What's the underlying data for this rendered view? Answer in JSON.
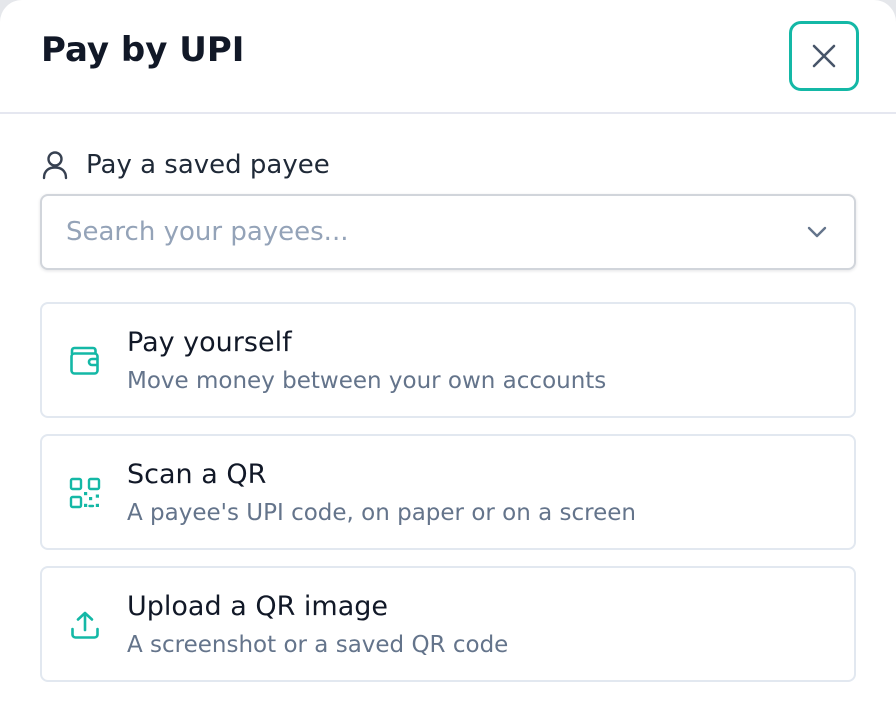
{
  "header": {
    "title": "Pay by UPI"
  },
  "saved_payee": {
    "label": "Pay a saved payee",
    "search_placeholder": "Search your payees..."
  },
  "options": [
    {
      "title": "Pay yourself",
      "description": "Move money between your own accounts",
      "icon": "wallet-icon"
    },
    {
      "title": "Scan a QR",
      "description": "A payee's UPI code, on paper or on a screen",
      "icon": "qr-code-icon"
    },
    {
      "title": "Upload a QR image",
      "description": "A screenshot or a saved QR code",
      "icon": "upload-icon"
    }
  ],
  "colors": {
    "accent": "#14b8a6",
    "title": "#111827",
    "muted": "#64748b",
    "border": "#e2e8f0"
  }
}
